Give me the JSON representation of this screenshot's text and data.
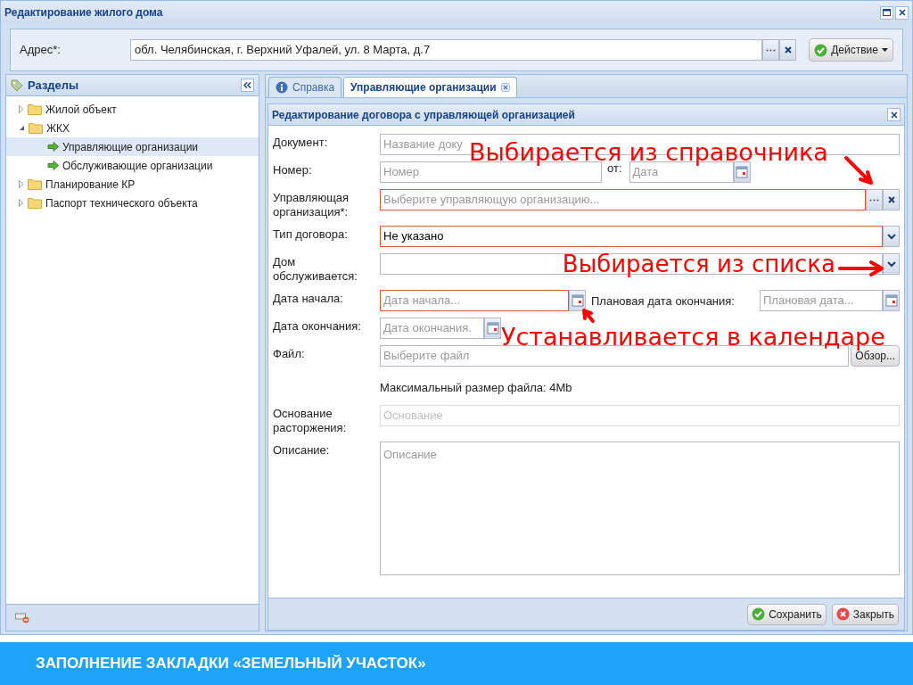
{
  "window": {
    "title": "Редактирование жилого дома"
  },
  "address": {
    "label": "Адрес*:",
    "value": "обл. Челябинская, г. Верхний Уфалей, ул. 8 Марта, д.7",
    "action_button": "Действие"
  },
  "sidebar": {
    "title": "Разделы",
    "items": [
      {
        "label": "Жилой объект",
        "expanded": false,
        "selected": false
      },
      {
        "label": "ЖКХ",
        "expanded": true,
        "selected": false,
        "children": [
          {
            "label": "Управляющие организации",
            "selected": true
          },
          {
            "label": "Обслуживающие организации",
            "selected": false
          }
        ]
      },
      {
        "label": "Планирование КР",
        "expanded": false,
        "selected": false
      },
      {
        "label": "Паспорт технического объекта",
        "expanded": false,
        "selected": false
      }
    ]
  },
  "tabs": [
    {
      "label": "Справка",
      "selected": false,
      "kind": "info"
    },
    {
      "label": "Управляющие организации",
      "selected": true,
      "kind": "closable"
    }
  ],
  "form": {
    "title": "Редактирование договора с управляющей организацией",
    "fields": [
      {
        "label": "Документ:",
        "kind": "text",
        "placeholder": "Название доку",
        "invalid": false
      },
      {
        "label": "Номер:",
        "kind": "text",
        "placeholder": "Номер",
        "invalid": false,
        "second": {
          "label": "от:",
          "placeholder": "Дата"
        }
      },
      {
        "label": "Управляющая организация*:",
        "kind": "lookup",
        "placeholder": "Выберите управляющую организацию...",
        "invalid": true
      },
      {
        "label": "Тип договора:",
        "kind": "combo",
        "value": "Не указано",
        "invalid": true
      },
      {
        "label": "Дом обслуживается:",
        "kind": "combo",
        "invalid": false,
        "note": "Выбирается из списка"
      },
      {
        "label": "Дата начала:",
        "kind": "date",
        "placeholder": "Дата начала...",
        "invalid": true,
        "second": {
          "label": "Плановая дата окончания:",
          "placeholder": "Плановая дата..."
        }
      },
      {
        "label": "Дата окончания:",
        "kind": "date",
        "placeholder": "Дата окончания.",
        "invalid": false
      },
      {
        "label": "Файл:",
        "kind": "file",
        "placeholder": "Выберите файл",
        "button": "Обзор...",
        "hint": "Максимальный размер файла: 4Mb",
        "invalid": false
      },
      {
        "label": "Основание расторжения:",
        "kind": "text",
        "placeholder": "Основание",
        "disabled": true,
        "invalid": false
      },
      {
        "label": "Описание:",
        "kind": "textarea",
        "placeholder": "Описание",
        "invalid": false
      }
    ],
    "buttons": [
      {
        "label": "Сохранить",
        "kind": "save"
      },
      {
        "label": "Закрыть",
        "kind": "close"
      }
    ]
  },
  "annotations": [
    {
      "text": "Выбирается из справочника"
    },
    {
      "text": "Устанавливается в календаре"
    }
  ],
  "caption": "ЗАПОЛНЕНИЕ ЗАКЛАДКИ «ЗЕМЕЛЬНЫЙ УЧАСТОК»"
}
